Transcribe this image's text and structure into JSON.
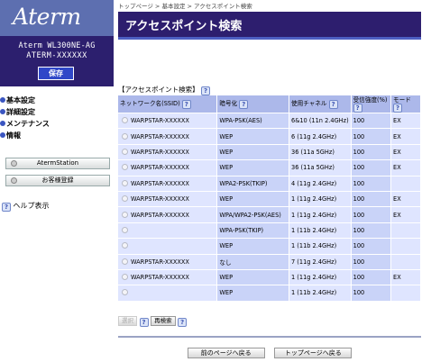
{
  "sidebar": {
    "logo": "Aterm",
    "model_line1": "Aterm WL300NE-AG",
    "model_line2": "ATERM-XXXXXX",
    "save_label": "保存",
    "menu": [
      {
        "label": "基本設定"
      },
      {
        "label": "詳細設定"
      },
      {
        "label": "メンテナンス"
      },
      {
        "label": "情報"
      }
    ],
    "buttons": [
      {
        "label": "AtermStation"
      },
      {
        "label": "お客様登録"
      }
    ],
    "help_label": "ヘルプ表示"
  },
  "main": {
    "breadcrumb": "トップページ > 基本設定 > アクセスポイント検索",
    "title": "アクセスポイント検索",
    "section_label": "【アクセスポイント検索】",
    "table": {
      "headers": [
        "ネットワーク名(SSID)",
        "暗号化",
        "使用チャネル",
        "受信強度(%)",
        "モード"
      ],
      "rows": [
        {
          "ssid": "WARPSTAR-XXXXXX",
          "enc": "WPA-PSK(AES)",
          "ch": "6&10 (11n 2.4GHz)",
          "strength": "100",
          "mode": "EX"
        },
        {
          "ssid": "WARPSTAR-XXXXXX",
          "enc": "WEP",
          "ch": "6 (11g 2.4GHz)",
          "strength": "100",
          "mode": "EX"
        },
        {
          "ssid": "WARPSTAR-XXXXXX",
          "enc": "WEP",
          "ch": "36 (11a 5GHz)",
          "strength": "100",
          "mode": "EX"
        },
        {
          "ssid": "WARPSTAR-XXXXXX",
          "enc": "WEP",
          "ch": "36 (11a 5GHz)",
          "strength": "100",
          "mode": "EX"
        },
        {
          "ssid": "WARPSTAR-XXXXXX",
          "enc": "WPA2-PSK(TKIP)",
          "ch": "4 (11g 2.4GHz)",
          "strength": "100",
          "mode": ""
        },
        {
          "ssid": "WARPSTAR-XXXXXX",
          "enc": "WEP",
          "ch": "1 (11g 2.4GHz)",
          "strength": "100",
          "mode": "EX"
        },
        {
          "ssid": "WARPSTAR-XXXXXX",
          "enc": "WPA/WPA2-PSK(AES)",
          "ch": "1 (11g 2.4GHz)",
          "strength": "100",
          "mode": "EX"
        },
        {
          "ssid": "",
          "enc": "WPA-PSK(TKIP)",
          "ch": "1 (11b 2.4GHz)",
          "strength": "100",
          "mode": ""
        },
        {
          "ssid": "",
          "enc": "WEP",
          "ch": "1 (11b 2.4GHz)",
          "strength": "100",
          "mode": ""
        },
        {
          "ssid": "WARPSTAR-XXXXXX",
          "enc": "なし",
          "ch": "7 (11g 2.4GHz)",
          "strength": "100",
          "mode": ""
        },
        {
          "ssid": "WARPSTAR-XXXXXX",
          "enc": "WEP",
          "ch": "1 (11g 2.4GHz)",
          "strength": "100",
          "mode": "EX"
        },
        {
          "ssid": "",
          "enc": "WEP",
          "ch": "1 (11b 2.4GHz)",
          "strength": "100",
          "mode": ""
        }
      ]
    },
    "select_label": "選択",
    "research_label": "再検索",
    "prev_label": "前のページへ戻る",
    "top_label": "トップページへ戻る"
  }
}
